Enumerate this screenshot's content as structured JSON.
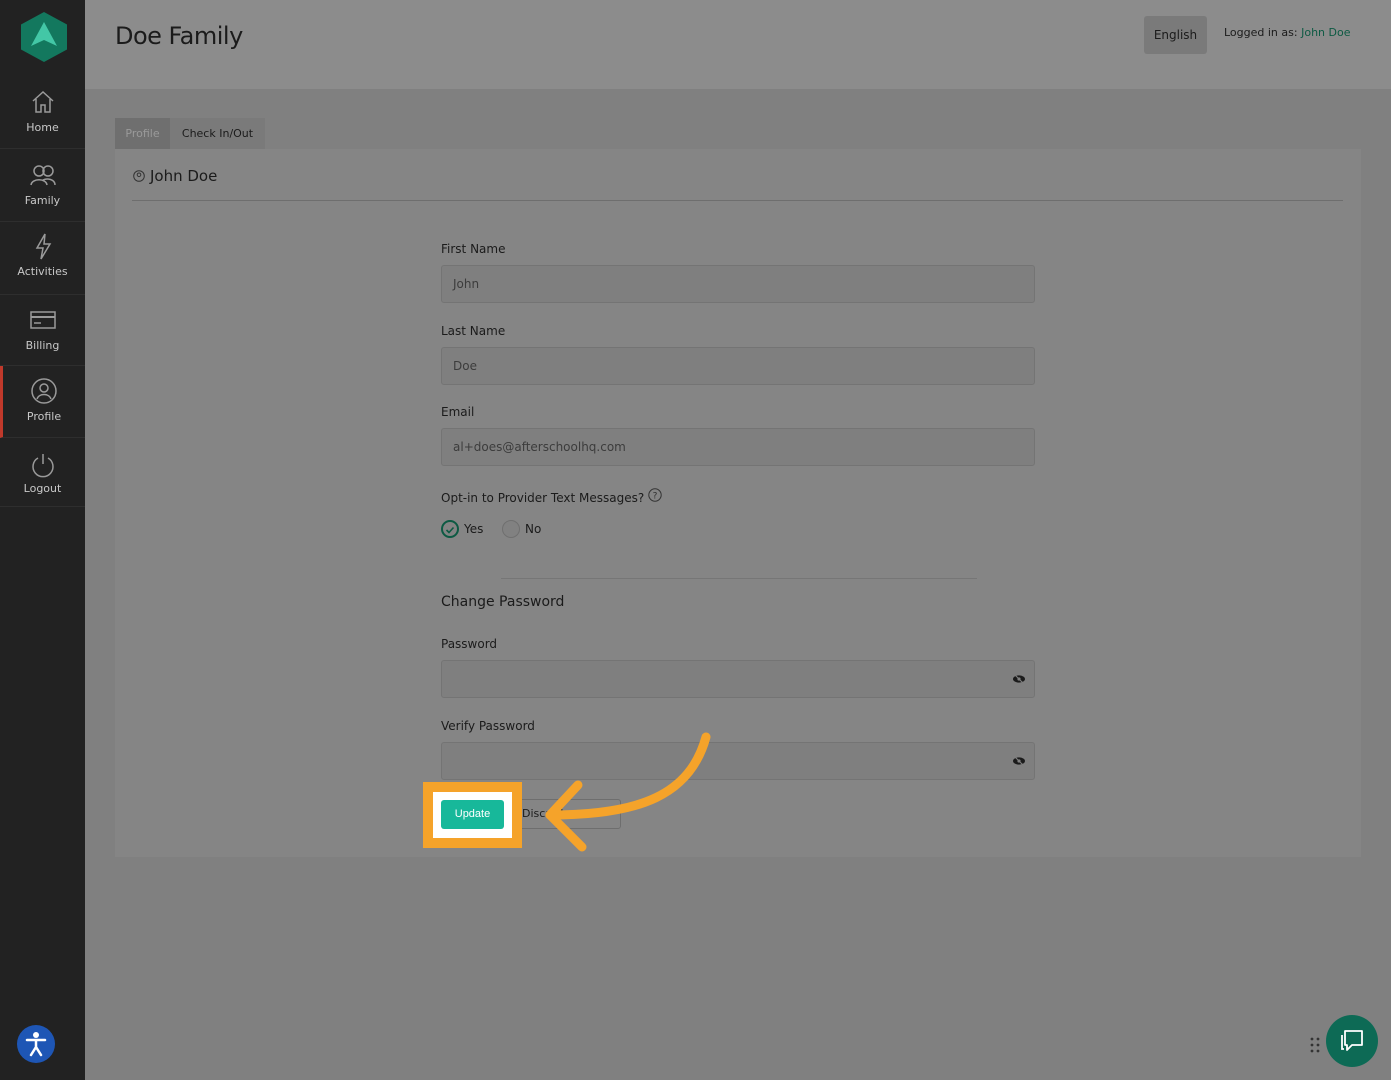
{
  "sidebar": {
    "items": [
      {
        "label": "Home",
        "icon": "home-icon"
      },
      {
        "label": "Family",
        "icon": "family-icon"
      },
      {
        "label": "Activities",
        "icon": "lightning-icon"
      },
      {
        "label": "Billing",
        "icon": "credit-card-icon"
      },
      {
        "label": "Profile",
        "icon": "user-circle-icon",
        "active": true
      },
      {
        "label": "Logout",
        "icon": "power-icon"
      }
    ]
  },
  "header": {
    "title": "Doe Family",
    "language": "English",
    "logged_in_prefix": "Logged in as:",
    "logged_in_user": "John Doe"
  },
  "tabs": [
    {
      "label": "Profile",
      "active": true
    },
    {
      "label": "Check In/Out",
      "active": false
    }
  ],
  "profile": {
    "heading": "John Doe",
    "fields": {
      "first_name": {
        "label": "First Name",
        "value": "John"
      },
      "last_name": {
        "label": "Last Name",
        "value": "Doe"
      },
      "email": {
        "label": "Email",
        "value": "al+does@afterschoolhq.com"
      }
    },
    "optin": {
      "label": "Opt-in to Provider Text Messages?",
      "options": [
        "Yes",
        "No"
      ],
      "selected": "Yes"
    },
    "change_password": {
      "title": "Change Password",
      "password_label": "Password",
      "verify_label": "Verify Password"
    },
    "update_button": "Update",
    "discard_button": "Discard"
  },
  "colors": {
    "sidebar_bg": "#222222",
    "accent_green": "#17b89a",
    "dark_green": "#0d5a43",
    "highlight_orange": "#f5a32a",
    "active_nav_border": "#c0392b"
  }
}
